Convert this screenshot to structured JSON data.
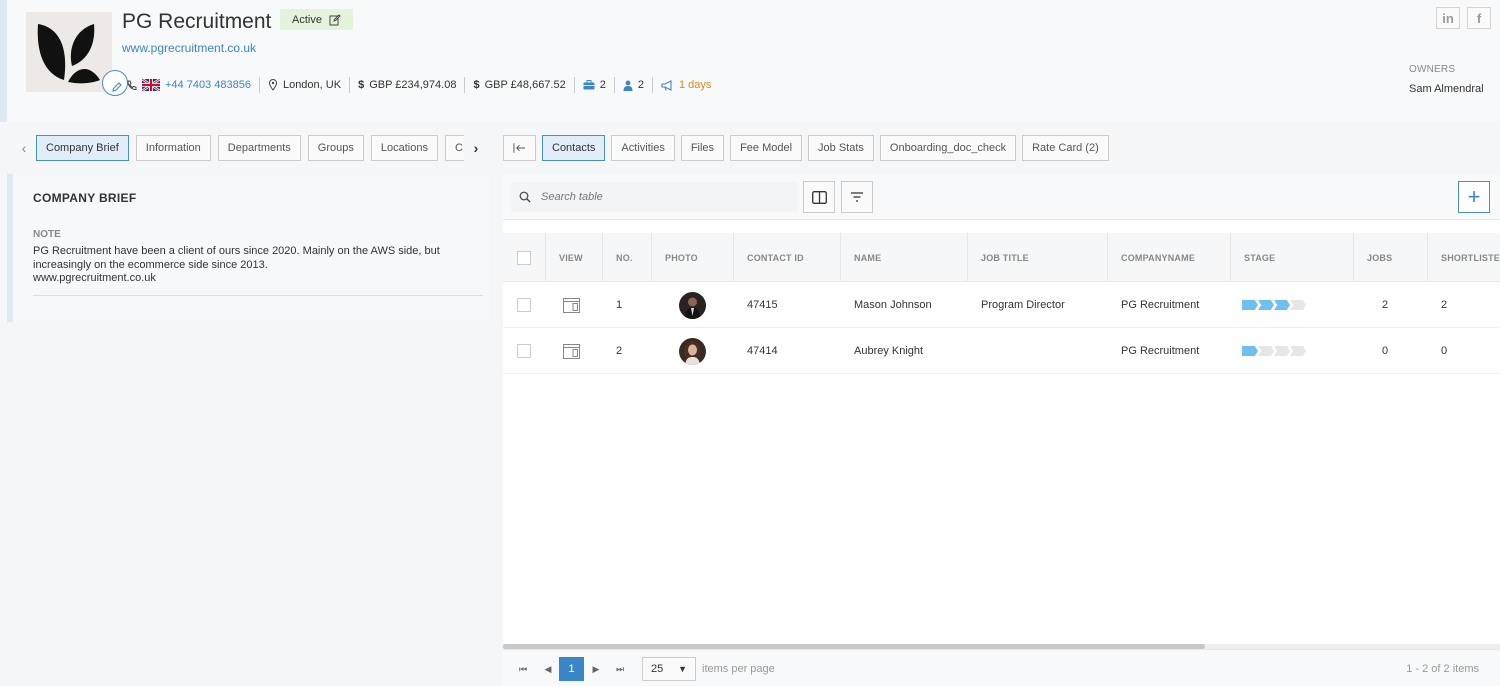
{
  "company": {
    "name": "PG Recruitment",
    "status": "Active",
    "website": "www.pgrecruitment.co.uk",
    "phone": "+44 7403 483856",
    "location": "London, UK",
    "revenue1": "GBP £234,974.08",
    "revenue2": "GBP £48,667.52",
    "jobs_count": "2",
    "contacts_count": "2",
    "days": "1 days"
  },
  "social": {
    "linkedin": "in",
    "facebook": "f"
  },
  "owners": {
    "label": "OWNERS",
    "name": "Sam Almendral"
  },
  "left_tabs": [
    "Company Brief",
    "Information",
    "Departments",
    "Groups",
    "Locations",
    "C"
  ],
  "right_tabs": [
    "Contacts",
    "Activities",
    "Files",
    "Fee Model",
    "Job Stats",
    "Onboarding_doc_check",
    "Rate Card (2)"
  ],
  "brief": {
    "title": "COMPANY BRIEF",
    "note_label": "NOTE",
    "note_text": "PG Recruitment have been a client of ours since 2020. Mainly on the AWS side, but increasingly on the ecommerce side since 2013.",
    "note_url": "www.pgrecruitment.co.uk"
  },
  "table": {
    "search_placeholder": "Search table",
    "columns": [
      "VIEW",
      "NO.",
      "PHOTO",
      "CONTACT ID",
      "NAME",
      "JOB TITLE",
      "COMPANYNAME",
      "STAGE",
      "JOBS",
      "SHORTLISTED"
    ],
    "rows": [
      {
        "no": "1",
        "contact_id": "47415",
        "name": "Mason Johnson",
        "job_title": "Program Director",
        "company": "PG Recruitment",
        "stage": 3,
        "jobs": "2",
        "shortlisted": "2"
      },
      {
        "no": "2",
        "contact_id": "47414",
        "name": "Aubrey Knight",
        "job_title": "",
        "company": "PG Recruitment",
        "stage": 1,
        "jobs": "0",
        "shortlisted": "0"
      }
    ]
  },
  "pager": {
    "current": "1",
    "page_size": "25",
    "items_label": "items per page",
    "count": "1 - 2 of 2 items"
  }
}
